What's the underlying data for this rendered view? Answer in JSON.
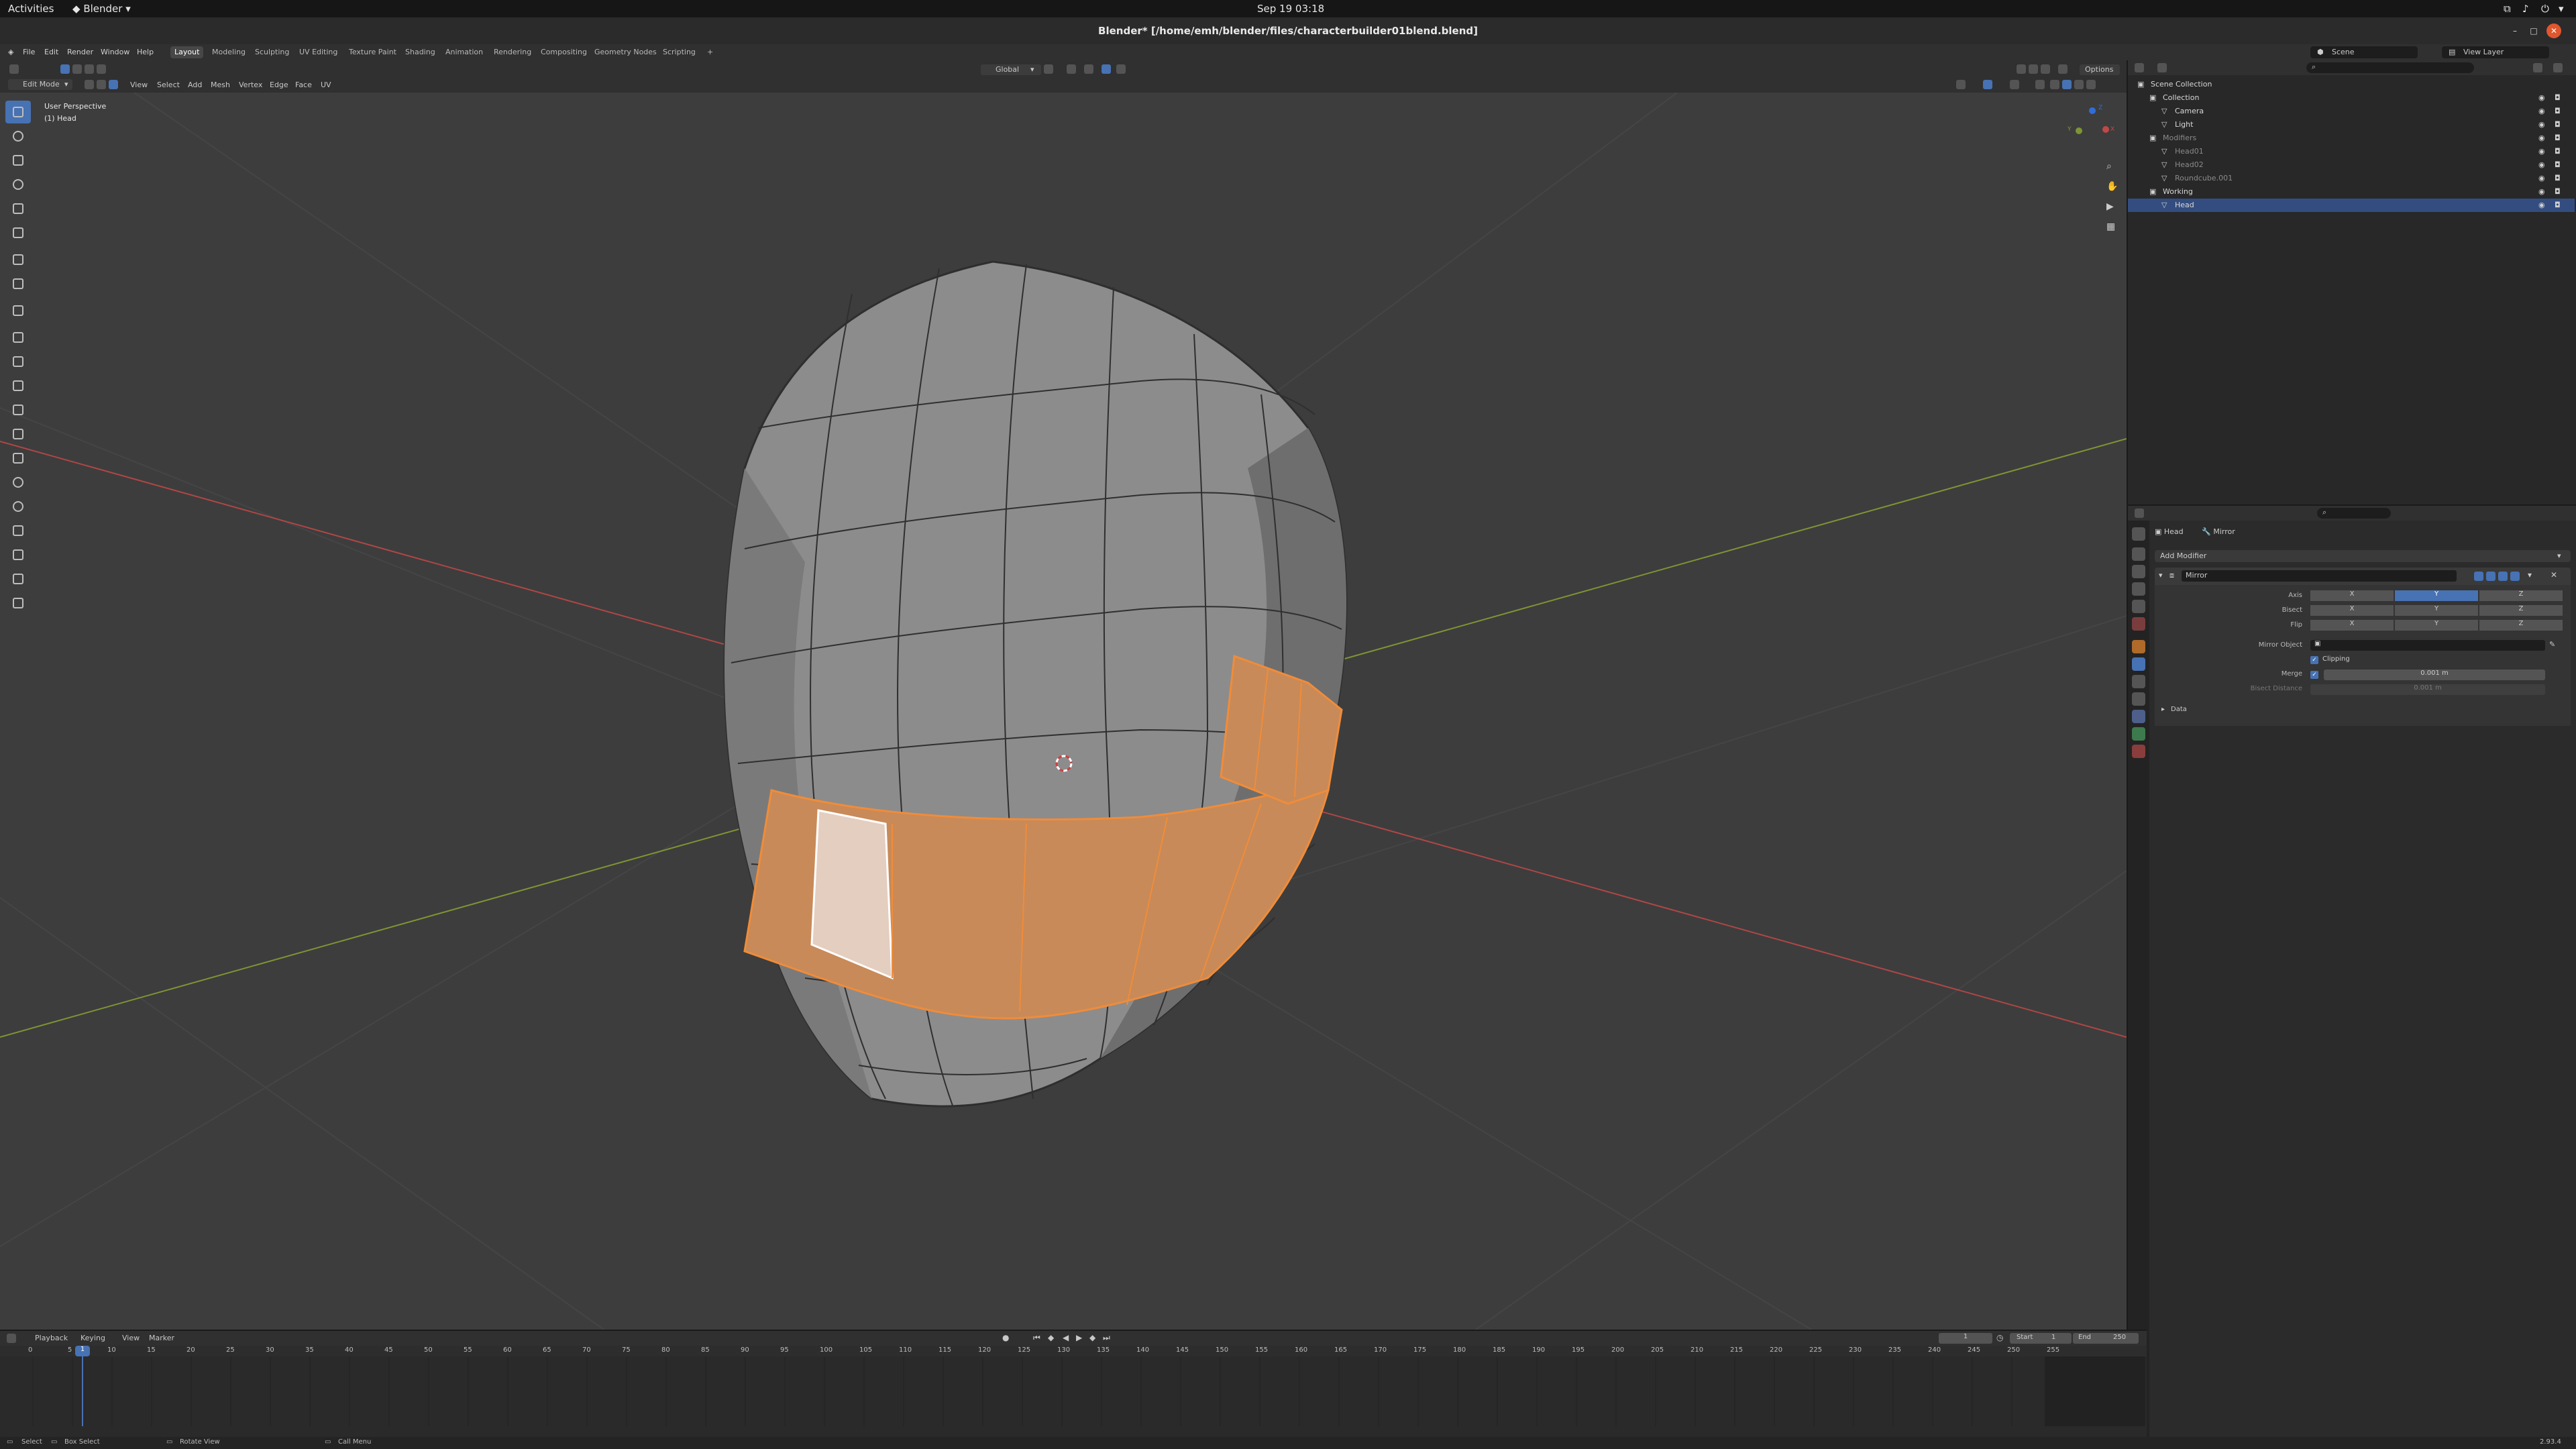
{
  "system_bar": {
    "activities": "Activities",
    "app_menu": "Blender",
    "clock": "Sep 19  03:18"
  },
  "window": {
    "title": "Blender* [/home/emh/blender/files/characterbuilder01blend.blend]"
  },
  "menubar": {
    "items": [
      "File",
      "Edit",
      "Render",
      "Window",
      "Help"
    ],
    "workspaces": [
      "Layout",
      "Modeling",
      "Sculpting",
      "UV Editing",
      "Texture Paint",
      "Shading",
      "Animation",
      "Rendering",
      "Compositing",
      "Geometry Nodes",
      "Scripting",
      "+"
    ],
    "active_workspace": "Layout",
    "scene_label": "Scene",
    "view_layer_label": "View Layer"
  },
  "viewport_header": {
    "mode": "Edit Mode",
    "menus": [
      "View",
      "Select",
      "Add",
      "Mesh",
      "Vertex",
      "Edge",
      "Face",
      "UV"
    ],
    "transform_orientation": "Global",
    "options_label": "Options"
  },
  "viewport": {
    "perspective_label": "User Perspective",
    "object_label": "(1) Head",
    "gizmo_axes": [
      "Z",
      "Y",
      "X"
    ]
  },
  "outliner": {
    "rows": [
      {
        "label": "Scene Collection",
        "indent": 0,
        "dim": false,
        "selected": false
      },
      {
        "label": "Collection",
        "indent": 1,
        "dim": false,
        "selected": false
      },
      {
        "label": "Camera",
        "indent": 2,
        "dim": false,
        "selected": false
      },
      {
        "label": "Light",
        "indent": 2,
        "dim": false,
        "selected": false
      },
      {
        "label": "Modifiers",
        "indent": 1,
        "dim": true,
        "selected": false
      },
      {
        "label": "Head01",
        "indent": 2,
        "dim": true,
        "selected": false
      },
      {
        "label": "Head02",
        "indent": 2,
        "dim": true,
        "selected": false
      },
      {
        "label": "Roundcube.001",
        "indent": 2,
        "dim": true,
        "selected": false
      },
      {
        "label": "Working",
        "indent": 1,
        "dim": false,
        "selected": false
      },
      {
        "label": "Head",
        "indent": 2,
        "dim": false,
        "selected": true
      }
    ]
  },
  "properties": {
    "breadcrumb_object": "Head",
    "breadcrumb_modifier": "Mirror",
    "add_modifier": "Add Modifier",
    "modifier_name": "Mirror",
    "axis_label": "Axis",
    "bisect_label": "Bisect",
    "flip_label": "Flip",
    "axes": [
      "X",
      "Y",
      "Z"
    ],
    "active_axis": "Y",
    "mirror_object_label": "Mirror Object",
    "clipping_label": "Clipping",
    "merge_label": "Merge",
    "merge_value": "0.001 m",
    "bisect_distance_label": "Bisect Distance",
    "bisect_distance_value": "0.001 m",
    "data_panel": "Data"
  },
  "timeline": {
    "menus": [
      "Playback",
      "Keying",
      "View",
      "Marker"
    ],
    "current_frame": "1",
    "start_label": "Start",
    "start_value": "1",
    "end_label": "End",
    "end_value": "250",
    "ticks": [
      "0",
      "5",
      "10",
      "15",
      "20",
      "25",
      "30",
      "35",
      "40",
      "45",
      "50",
      "55",
      "60",
      "65",
      "70",
      "75",
      "80",
      "85",
      "90",
      "95",
      "100",
      "105",
      "110",
      "115",
      "120",
      "125",
      "130",
      "135",
      "140",
      "145",
      "150",
      "155",
      "160",
      "165",
      "170",
      "175",
      "180",
      "185",
      "190",
      "195",
      "200",
      "205",
      "210",
      "215",
      "220",
      "225",
      "230",
      "235",
      "240",
      "245",
      "250",
      "255"
    ]
  },
  "statusbar": {
    "select": "Select",
    "box_select": "Box Select",
    "rotate_view": "Rotate View",
    "call_menu": "Call Menu",
    "version": "2.93.4"
  },
  "colors": {
    "viewport_bg": "#3d3d3d",
    "selection_orange": "#e8954c",
    "active_blue": "#4772b3",
    "x_axis": "#c04848",
    "y_axis": "#8ca33a"
  }
}
